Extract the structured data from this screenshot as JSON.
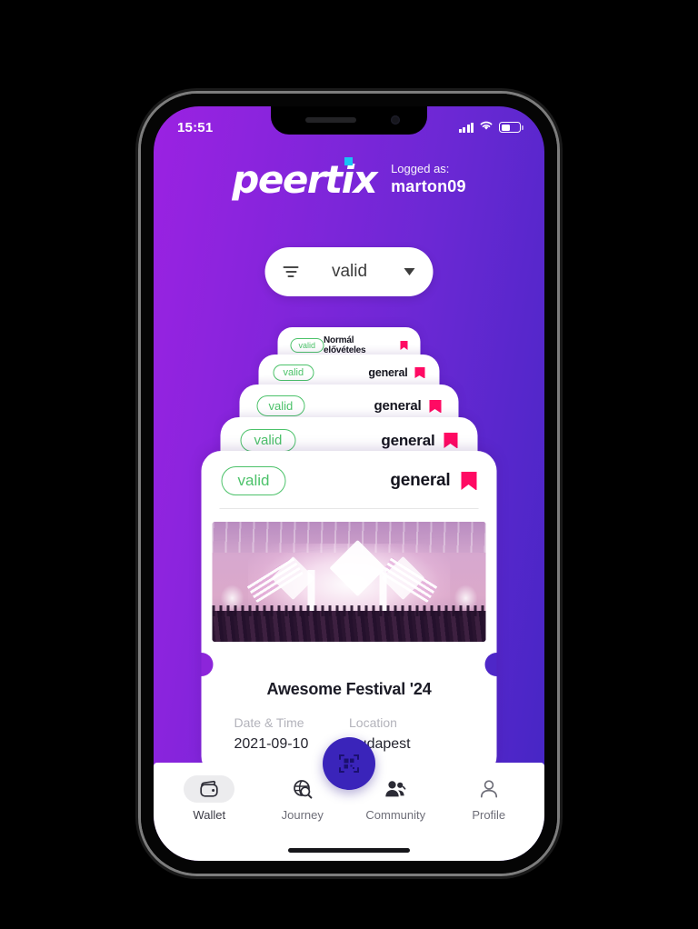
{
  "status_bar": {
    "time": "15:51",
    "signal_icon": "signal-bars-icon",
    "wifi_icon": "wifi-icon",
    "battery_icon": "battery-icon"
  },
  "header": {
    "brand": "peertix",
    "logged_label": "Logged as:",
    "username": "marton09"
  },
  "filter": {
    "icon": "filter-icon",
    "value": "valid",
    "caret_icon": "chevron-down-icon"
  },
  "ticket_stack": [
    {
      "status": "valid",
      "category": "Normál elővételes",
      "bookmark_icon": "bookmark-icon"
    },
    {
      "status": "valid",
      "category": "general",
      "bookmark_icon": "bookmark-icon"
    },
    {
      "status": "valid",
      "category": "general",
      "bookmark_icon": "bookmark-icon"
    },
    {
      "status": "valid",
      "category": "general",
      "bookmark_icon": "bookmark-icon"
    }
  ],
  "front_ticket": {
    "status": "valid",
    "category": "general",
    "bookmark_icon": "bookmark-icon",
    "image_alt": "festival-stage-photo",
    "event_title": "Awesome Festival '24",
    "date_label": "Date & Time",
    "date_value": "2021-09-10",
    "location_label": "Location",
    "location_value": "Budapest"
  },
  "scan_button": {
    "icon": "qr-scan-icon"
  },
  "bottom_nav": [
    {
      "label": "Wallet",
      "icon": "wallet-icon",
      "active": true
    },
    {
      "label": "Journey",
      "icon": "globe-search-icon",
      "active": false
    },
    {
      "label": "Community",
      "icon": "people-icon",
      "active": false
    },
    {
      "label": "Profile",
      "icon": "person-icon",
      "active": false
    }
  ],
  "colors": {
    "gradient_start": "#9b22e2",
    "gradient_end": "#4426c4",
    "valid_green": "#4cc26a",
    "bookmark_pink": "#ff0a63",
    "fab_indigo": "#3a24ba",
    "brand_dot_cyan": "#19c3f5"
  }
}
